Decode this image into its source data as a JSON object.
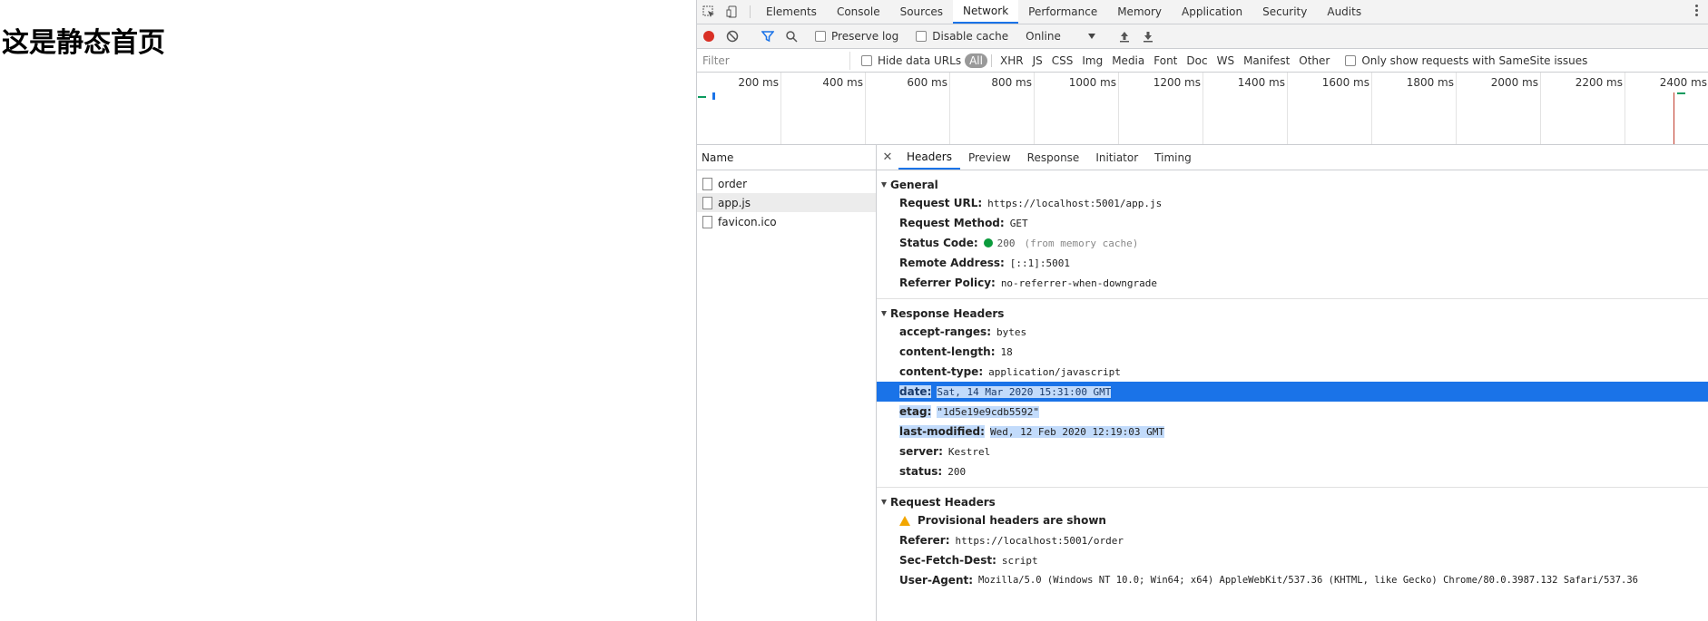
{
  "page": {
    "heading": "这是静态首页"
  },
  "devtools": {
    "tabs": [
      "Elements",
      "Console",
      "Sources",
      "Network",
      "Performance",
      "Memory",
      "Application",
      "Security",
      "Audits"
    ],
    "active_tab": "Network",
    "toolbar": {
      "preserve_log": "Preserve log",
      "disable_cache": "Disable cache",
      "throttling": "Online"
    },
    "filter": {
      "placeholder": "Filter",
      "hide_data_urls": "Hide data URLs",
      "types": [
        "All",
        "XHR",
        "JS",
        "CSS",
        "Img",
        "Media",
        "Font",
        "Doc",
        "WS",
        "Manifest",
        "Other"
      ],
      "samesite": "Only show requests with SameSite issues"
    },
    "overview": {
      "ticks": [
        "200 ms",
        "400 ms",
        "600 ms",
        "800 ms",
        "1000 ms",
        "1200 ms",
        "1400 ms",
        "1600 ms",
        "1800 ms",
        "2000 ms",
        "2200 ms",
        "2400 ms"
      ]
    },
    "requests": {
      "header": "Name",
      "items": [
        "order",
        "app.js",
        "favicon.ico"
      ],
      "selected": "app.js"
    },
    "detail_tabs": [
      "Headers",
      "Preview",
      "Response",
      "Initiator",
      "Timing"
    ],
    "general": {
      "title": "General",
      "rows": [
        {
          "key": "Request URL:",
          "value": "https://localhost:5001/app.js"
        },
        {
          "key": "Request Method:",
          "value": "GET"
        },
        {
          "key": "Status Code:",
          "value": "200",
          "note": "(from memory cache)"
        },
        {
          "key": "Remote Address:",
          "value": "[::1]:5001"
        },
        {
          "key": "Referrer Policy:",
          "value": "no-referrer-when-downgrade"
        }
      ]
    },
    "response_headers": {
      "title": "Response Headers",
      "rows": [
        {
          "key": "accept-ranges:",
          "value": "bytes"
        },
        {
          "key": "content-length:",
          "value": "18"
        },
        {
          "key": "content-type:",
          "value": "application/javascript"
        },
        {
          "key": "date:",
          "value": "Sat, 14 Mar 2020 15:31:00 GMT"
        },
        {
          "key": "etag:",
          "value": "\"1d5e19e9cdb5592\""
        },
        {
          "key": "last-modified:",
          "value": "Wed, 12 Feb 2020 12:19:03 GMT"
        },
        {
          "key": "server:",
          "value": "Kestrel"
        },
        {
          "key": "status:",
          "value": "200"
        }
      ]
    },
    "request_headers": {
      "title": "Request Headers",
      "warning": "Provisional headers are shown",
      "rows": [
        {
          "key": "Referer:",
          "value": "https://localhost:5001/order"
        },
        {
          "key": "Sec-Fetch-Dest:",
          "value": "script"
        },
        {
          "key": "User-Agent:",
          "value": "Mozilla/5.0 (Windows NT 10.0; Win64; x64) AppleWebKit/537.36 (KHTML, like Gecko) Chrome/80.0.3987.132 Safari/537.36"
        }
      ]
    }
  }
}
